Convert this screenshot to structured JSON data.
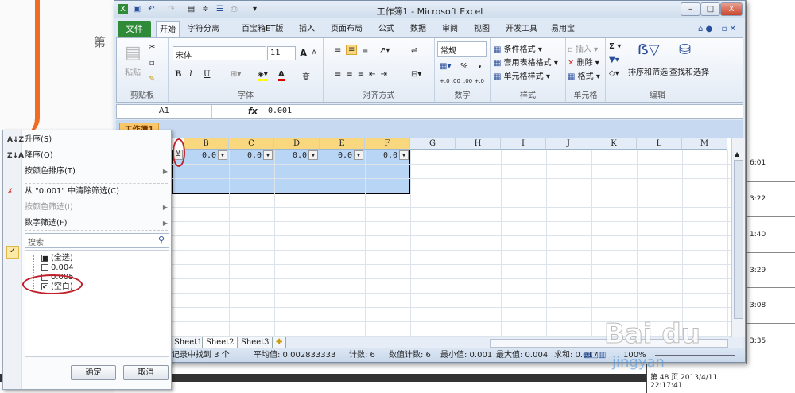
{
  "background": {
    "left_text": "第",
    "right_times": [
      "6:01",
      "3:22",
      "1:40",
      "3:29",
      "3:08",
      "3:35"
    ],
    "page_info": "第 48 页  2013/4/11 22:17:41"
  },
  "window": {
    "title": "工作簿1 - Microsoft Excel",
    "controls": [
      "–",
      "□",
      "X"
    ]
  },
  "tabs": {
    "file": "文件",
    "items": [
      "开始",
      "字符分离",
      "百宝箱ET版",
      "插入",
      "页面布局",
      "公式",
      "数据",
      "审阅",
      "视图",
      "开发工具",
      "易用宝"
    ]
  },
  "ribbon": {
    "clipboard": {
      "label": "剪贴板",
      "paste": "粘贴"
    },
    "font": {
      "label": "字体",
      "name": "宋体",
      "size": "11",
      "bold": "B",
      "italic": "I",
      "underline": "U",
      "grow": "A",
      "shrink": "A",
      "font_color": "A",
      "phonetic": "变"
    },
    "alignment": {
      "label": "对齐方式"
    },
    "number": {
      "label": "数字",
      "format": "常规",
      "percent": "%",
      "comma": ",",
      "inc": "+.0 .00",
      "dec": ".00 +.0"
    },
    "styles": {
      "label": "样式",
      "items": [
        "条件格式 ▾",
        "套用表格格式 ▾",
        "单元格样式 ▾"
      ]
    },
    "cells": {
      "label": "单元格",
      "items": [
        "插入 ▾",
        "删除 ▾",
        "格式 ▾"
      ]
    },
    "editing": {
      "label": "编辑",
      "sigma": "Σ ▾",
      "sort_filter": "排序和筛选",
      "find_select": "查找和选择"
    }
  },
  "formula_bar": {
    "name_box": "A1",
    "fx": "fx",
    "value": "0.001"
  },
  "workbook_tab": "工作簿1",
  "grid": {
    "columns": [
      "B",
      "C",
      "D",
      "E",
      "F",
      "G",
      "H",
      "I",
      "J",
      "K",
      "L",
      "M"
    ],
    "row1": [
      "0.0",
      "0.0",
      "0.0",
      "0.0",
      "0.0"
    ]
  },
  "sheets": [
    "Sheet1",
    "Sheet2",
    "Sheet3"
  ],
  "status": {
    "found": "记录中找到 3 个",
    "average": "平均值: 0.002833333",
    "count": "计数: 6",
    "num_count": "数值计数: 6",
    "min": "最小值: 0.001",
    "max": "最大值: 0.004",
    "sum": "求和: 0.017",
    "zoom": "100%"
  },
  "filter_menu": {
    "items": [
      {
        "icon": "A↓Z",
        "label": "升序(S)"
      },
      {
        "icon": "Z↓A",
        "label": "降序(O)"
      },
      {
        "label": "按颜色排序(T)",
        "arrow": "▶"
      },
      {
        "icon": "✗",
        "label": "从 \"0.001\" 中清除筛选(C)"
      },
      {
        "label": "按颜色筛选(I)",
        "arrow": "▶",
        "disabled": true
      },
      {
        "label": "数字筛选(F)",
        "arrow": "▶"
      }
    ],
    "search_placeholder": "搜索",
    "list": [
      {
        "label": "(全选)",
        "state": "mixed"
      },
      {
        "label": "0.004",
        "state": "unchecked"
      },
      {
        "label": "0.005",
        "state": "unchecked"
      },
      {
        "label": "(空白)",
        "state": "checked"
      }
    ],
    "ok": "确定",
    "cancel": "取消"
  },
  "watermark": {
    "text": "Baidu经验",
    "site": "jingyan.baidu.com"
  }
}
